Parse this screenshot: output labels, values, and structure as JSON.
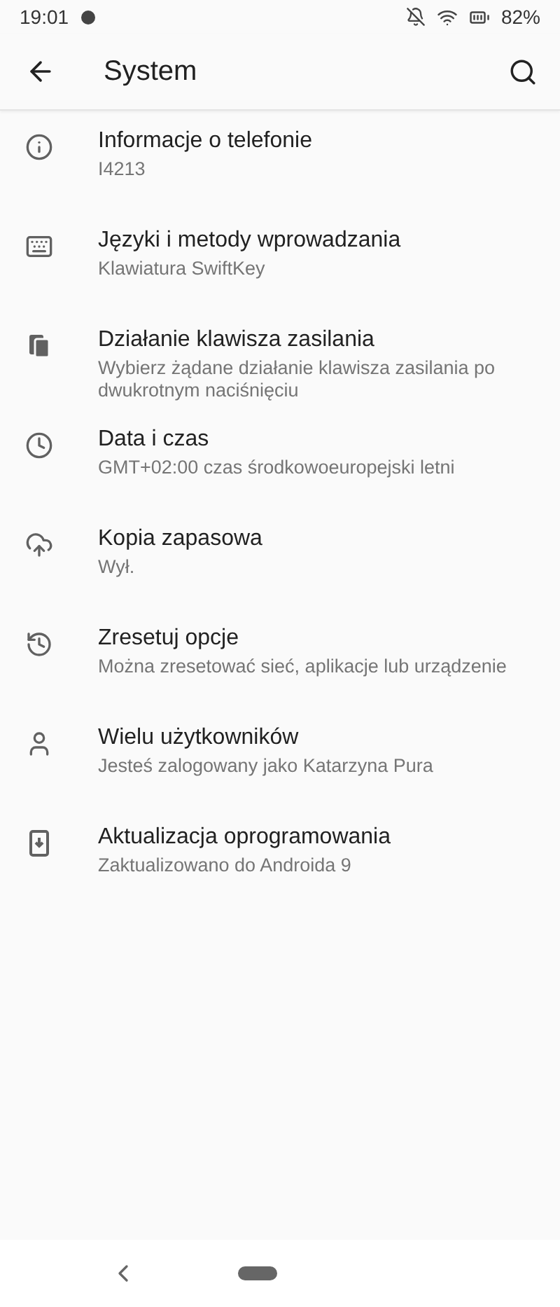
{
  "status_bar": {
    "time": "19:01",
    "battery": "82%"
  },
  "app_bar": {
    "title": "System"
  },
  "items": [
    {
      "title": "Informacje o telefonie",
      "summary": "I4213"
    },
    {
      "title": "Języki i metody wprowadzania",
      "summary": "Klawiatura SwiftKey"
    },
    {
      "title": "Działanie klawisza zasilania",
      "summary": "Wybierz żądane działanie klawisza zasilania po dwukrotnym naciśnięciu"
    },
    {
      "title": "Data i czas",
      "summary": "GMT+02:00 czas środkowoeuropejski letni"
    },
    {
      "title": "Kopia zapasowa",
      "summary": "Wył."
    },
    {
      "title": "Zresetuj opcje",
      "summary": "Można zresetować sieć, aplikacje lub urządzenie"
    },
    {
      "title": "Wielu użytkowników",
      "summary": "Jesteś zalogowany jako Katarzyna Pura"
    },
    {
      "title": "Aktualizacja oprogramowania",
      "summary": "Zaktualizowano do Androida 9"
    }
  ]
}
